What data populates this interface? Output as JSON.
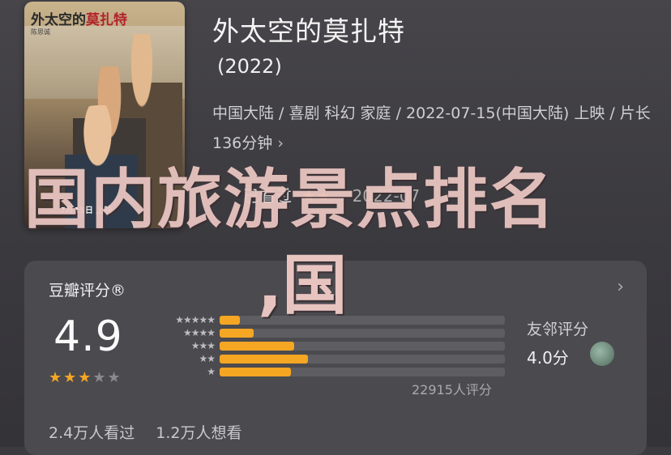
{
  "poster": {
    "title_part1": "外太空的",
    "title_part2": "莫扎特",
    "cast": "陈思诚",
    "release": "7月15日 上映"
  },
  "movie": {
    "title": "外太空的莫扎特",
    "year": "(2022)",
    "meta": "中国大陆 / 喜剧 科幻 家庭 / 2022-07-15(中国大陆) 上映 / 片长136分钟",
    "chevron": "›"
  },
  "my_rating": {
    "label": "已看过",
    "stars": "★★",
    "date": "2022-07"
  },
  "overlay": {
    "line1": "国内旅游景点排名",
    "line2": ",国"
  },
  "rating_card": {
    "title": "豆瓣评分®",
    "chevron": "›",
    "score": "4.9",
    "score_stars_on": "★★",
    "score_star_half": "★",
    "score_stars_off": "★★",
    "distribution": [
      {
        "stars": "★★★★★",
        "fraction": 0.07
      },
      {
        "stars": "★★★★",
        "fraction": 0.12
      },
      {
        "stars": "★★★",
        "fraction": 0.26
      },
      {
        "stars": "★★",
        "fraction": 0.31
      },
      {
        "stars": "★",
        "fraction": 0.25
      }
    ],
    "count": "22915人评分",
    "friend_title": "友邻评分",
    "friend_score": "4.0分",
    "watched": "2.4万人看过",
    "wanted": "1.2万人想看"
  },
  "colors": {
    "accent": "#f5a623",
    "background": "#3b3a3e",
    "card": "#4b4a4f"
  }
}
